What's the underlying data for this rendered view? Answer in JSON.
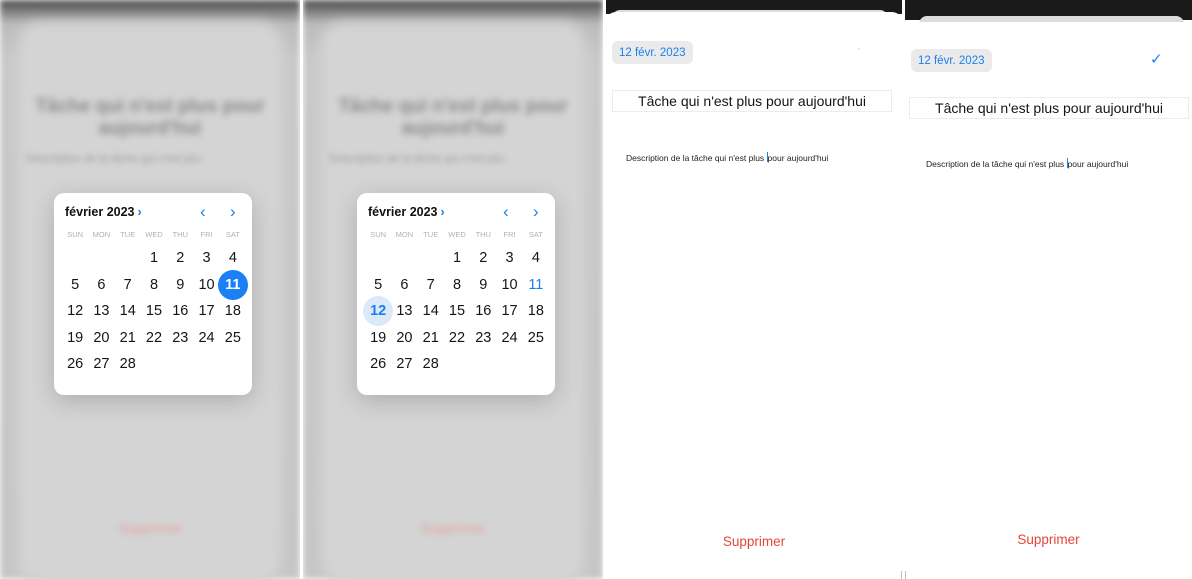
{
  "calendar": {
    "month_label": "février 2023",
    "month_chevron": "›",
    "prev_arrow": "‹",
    "next_arrow": "›",
    "weekdays": [
      "SUN",
      "MON",
      "TUE",
      "WED",
      "THU",
      "FRI",
      "SAT"
    ],
    "days": [
      "1",
      "2",
      "3",
      "4",
      "5",
      "6",
      "7",
      "8",
      "9",
      "10",
      "11",
      "12",
      "13",
      "14",
      "15",
      "16",
      "17",
      "18",
      "19",
      "20",
      "21",
      "22",
      "23",
      "24",
      "25",
      "26",
      "27",
      "28"
    ],
    "first_weekday_index": 3
  },
  "panel1": {
    "selected_day": "11"
  },
  "panel2": {
    "selected_day": "12",
    "today_day": "11"
  },
  "form": {
    "date_chip": "12 févr. 2023",
    "title_value": "Tâche qui n'est plus pour aujourd'hui",
    "description_before_caret": "Description de la tâche qui n'est plus ",
    "description_after_caret": "pour aujourd'hui",
    "description_full": "Description de la tâche qui n'est plus pour aujourd'hui",
    "delete_label": "Supprimer",
    "checkmark_icon": "✓",
    "dot": "·"
  },
  "colors": {
    "accent": "#1a7ff0",
    "danger": "#e5453a",
    "selected_fill": "#1b7ff5",
    "selected_light": "#dbe9f8"
  }
}
